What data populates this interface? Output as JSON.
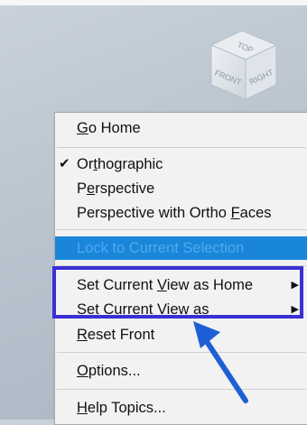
{
  "viewcube": {
    "top": "TOP",
    "front": "FRONT",
    "right": "RIGHT"
  },
  "menu": {
    "go_home": {
      "pre": "",
      "u": "G",
      "post": "o Home"
    },
    "orthographic": {
      "pre": "Or",
      "u": "t",
      "post": "hographic",
      "checked": true
    },
    "perspective": {
      "pre": "P",
      "u": "e",
      "post": "rspective"
    },
    "perspective_ortho": {
      "pre": "Perspective with Ortho ",
      "u": "F",
      "post": "aces"
    },
    "lock": {
      "text": "Lock to Current Selection"
    },
    "set_home": {
      "pre": "Set Current ",
      "u": "V",
      "post": "iew as Home"
    },
    "set_view_as": {
      "pre": "",
      "u": "S",
      "post": "et Current View as"
    },
    "reset_front": {
      "pre": "",
      "u": "R",
      "post": "eset Front"
    },
    "options": {
      "pre": "",
      "u": "O",
      "post": "ptions..."
    },
    "help": {
      "pre": "",
      "u": "H",
      "post": "elp Topics..."
    },
    "check_glyph": "✔",
    "submenu_glyph": "▶"
  },
  "colors": {
    "highlight": "#1a86d9",
    "callout": "#3a2fd6",
    "arrow": "#1f5fd6"
  }
}
